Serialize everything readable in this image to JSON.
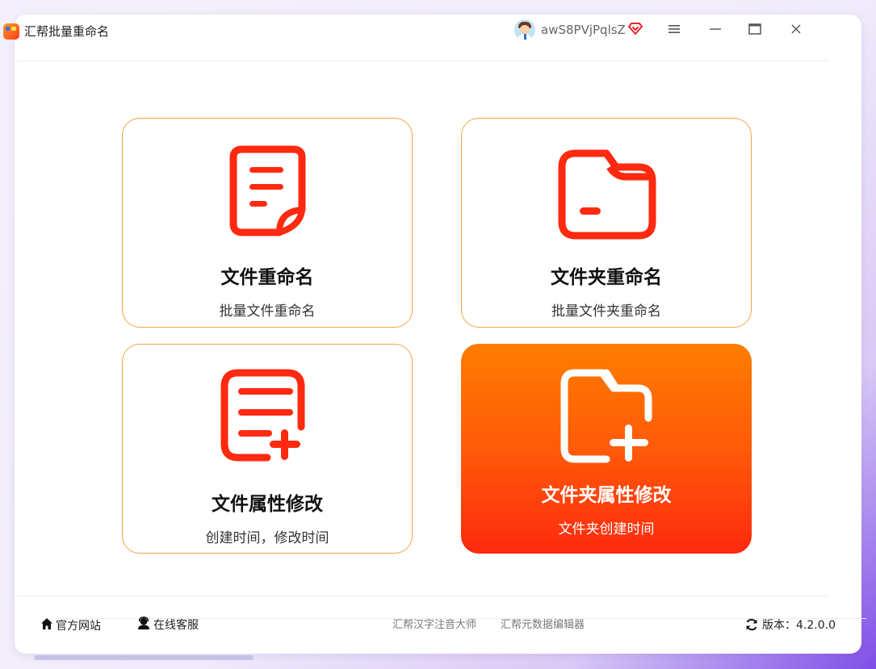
{
  "app": {
    "title": "汇帮批量重命名",
    "username": "awS8PVjPqlsZ"
  },
  "icons": {
    "app_logo": "app-logo-icon",
    "avatar": "user-avatar",
    "vip": "vip-diamond-icon",
    "menu": "hamburger-menu-icon",
    "minimize": "minimize-icon",
    "maximize": "maximize-icon",
    "close": "close-icon"
  },
  "cards": [
    {
      "title": "文件重命名",
      "subtitle": "批量文件重命名",
      "icon": "file-document-icon",
      "active": false
    },
    {
      "title": "文件夹重命名",
      "subtitle": "批量文件夹重命名",
      "icon": "folder-icon",
      "active": false
    },
    {
      "title": "文件属性修改",
      "subtitle": "创建时间，修改时间",
      "icon": "file-add-icon",
      "active": false
    },
    {
      "title": "文件夹属性修改",
      "subtitle": "文件夹创建时间",
      "icon": "folder-add-icon",
      "active": true
    }
  ],
  "footer": {
    "website": "官方网站",
    "support": "在线客服",
    "link1": "汇帮汉字注音大师",
    "link2": "汇帮元数据编辑器",
    "version": "版本：4.2.0.0"
  },
  "colors": {
    "accent": "#ff2a0f",
    "accent_gradient_top": "#ff7d00",
    "card_border": "#f2a645",
    "vip": "#e8232e",
    "background_purple": "#7f4ee8"
  }
}
